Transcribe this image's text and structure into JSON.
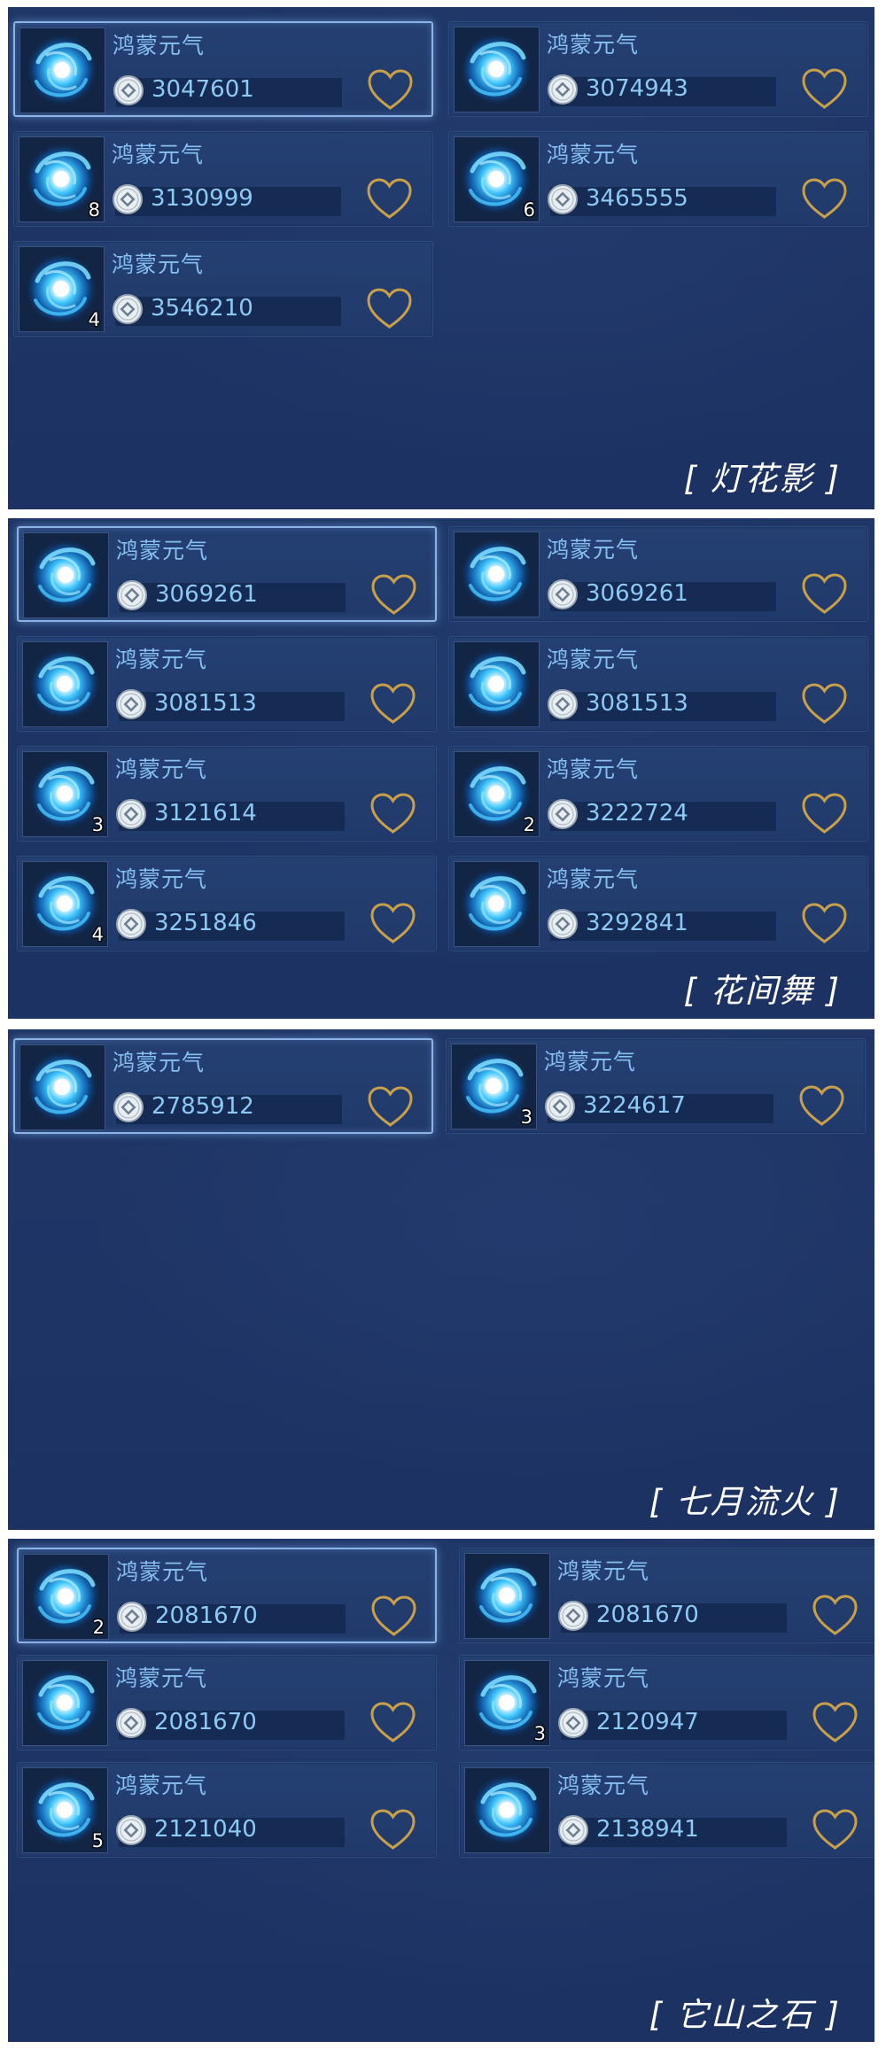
{
  "item_name": "鸿蒙元气",
  "colors": {
    "panel_bg": "#1e3465",
    "accent_text": "#86c0f2",
    "heart": "#c9a04a"
  },
  "icons": {
    "item": "swirl-orb-icon",
    "currency": "silver-coin-icon",
    "favorite": "heart-icon"
  },
  "panels": [
    {
      "server": "[ 灯花影 ]",
      "listings": [
        {
          "price": "3047601",
          "count": "",
          "selected": true
        },
        {
          "price": "3074943",
          "count": ""
        },
        {
          "price": "3130999",
          "count": "8"
        },
        {
          "price": "3465555",
          "count": "6"
        },
        {
          "price": "3546210",
          "count": "4"
        }
      ]
    },
    {
      "server": "[ 花间舞 ]",
      "listings": [
        {
          "price": "3069261",
          "count": "",
          "selected": true
        },
        {
          "price": "3069261",
          "count": ""
        },
        {
          "price": "3081513",
          "count": ""
        },
        {
          "price": "3081513",
          "count": ""
        },
        {
          "price": "3121614",
          "count": "3"
        },
        {
          "price": "3222724",
          "count": "2"
        },
        {
          "price": "3251846",
          "count": "4"
        },
        {
          "price": "3292841",
          "count": ""
        }
      ]
    },
    {
      "server": "[ 七月流火 ]",
      "listings": [
        {
          "price": "2785912",
          "count": "",
          "selected": true
        },
        {
          "price": "3224617",
          "count": "3"
        }
      ]
    },
    {
      "server": "[ 它山之石 ]",
      "listings": [
        {
          "price": "2081670",
          "count": "2",
          "selected": true
        },
        {
          "price": "2081670",
          "count": ""
        },
        {
          "price": "2081670",
          "count": ""
        },
        {
          "price": "2120947",
          "count": "3"
        },
        {
          "price": "2121040",
          "count": "5"
        },
        {
          "price": "2138941",
          "count": ""
        }
      ]
    }
  ]
}
